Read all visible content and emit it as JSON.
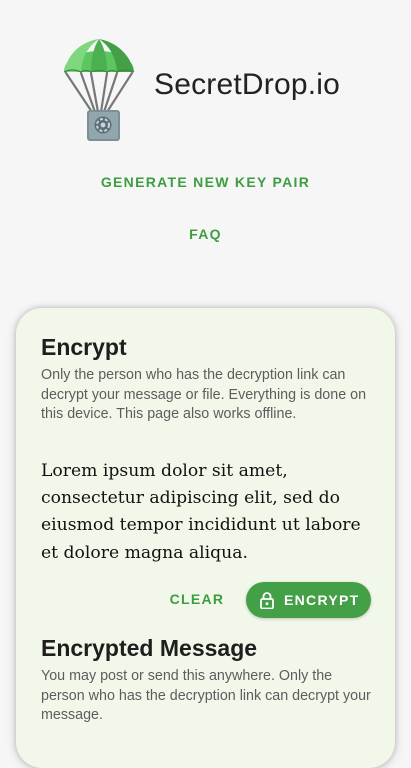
{
  "header": {
    "site_title": "SecretDrop.io",
    "logo_icon": "parachute-safe-icon",
    "links": {
      "generate": "GENERATE NEW KEY PAIR",
      "faq": "FAQ"
    }
  },
  "encrypt_card": {
    "title": "Encrypt",
    "description": "Only the person who has the decryption link can decrypt your message or file. Everything is done on this device. This page also works offline.",
    "message": "Lorem ipsum dolor sit amet, consectetur adipiscing elit, sed do eiusmod tempor incididunt ut labore et dolore magna aliqua.",
    "clear_label": "CLEAR",
    "encrypt_label": "ENCRYPT",
    "encrypt_icon": "lock-icon"
  },
  "encrypted_section": {
    "title": "Encrypted Message",
    "description": "You may post or send this anywhere. Only the person who has the decryption link can decrypt your message."
  },
  "colors": {
    "accent": "#43a047",
    "link": "#3d9e41",
    "card_background": "#f1f7e9",
    "page_background": "#f6f6f6"
  }
}
